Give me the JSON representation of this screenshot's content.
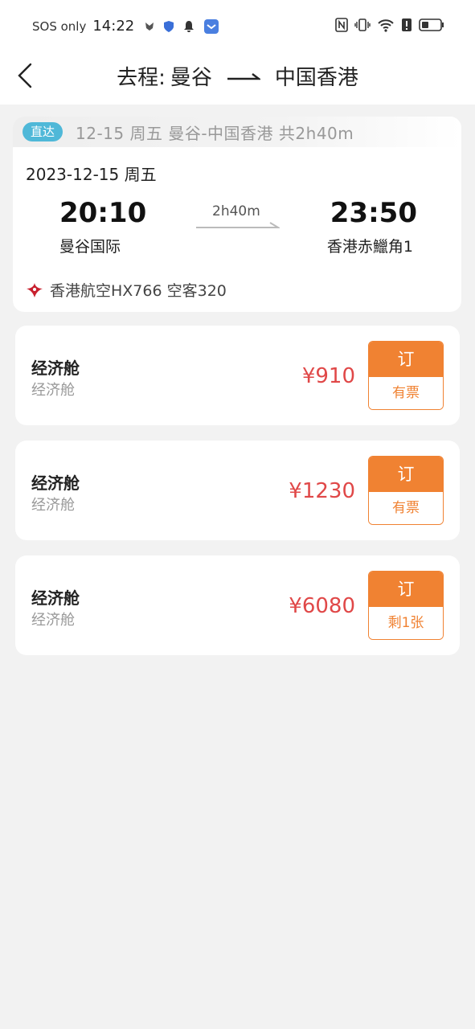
{
  "status_bar": {
    "carrier": "SOS only",
    "time": "14:22"
  },
  "nav": {
    "prefix": "去程:",
    "from": "曼谷",
    "to": "中国香港"
  },
  "flight": {
    "badge": "直达",
    "summary": "12-15 周五  曼谷-中国香港  共2h40m",
    "date": "2023-12-15 周五",
    "departure_time": "20:10",
    "departure_airport": "曼谷国际",
    "duration": "2h40m",
    "arrival_time": "23:50",
    "arrival_airport": "香港赤鱲角1",
    "airline": "香港航空HX766  空客320"
  },
  "fares": [
    {
      "class": "经济舱",
      "subclass": "经济舱",
      "price": "¥910",
      "button": "订",
      "availability": "有票"
    },
    {
      "class": "经济舱",
      "subclass": "经济舱",
      "price": "¥1230",
      "button": "订",
      "availability": "有票"
    },
    {
      "class": "经济舱",
      "subclass": "经济舱",
      "price": "¥6080",
      "button": "订",
      "availability": "剩1张"
    }
  ],
  "colors": {
    "accent": "#f08232",
    "price": "#e04848",
    "badge": "#4fb8d8"
  }
}
